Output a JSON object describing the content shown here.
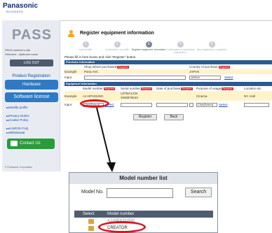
{
  "brand": {
    "name": "Panasonic",
    "sub": "BUSINESS"
  },
  "sidebar": {
    "logo": "PASS",
    "member_site": "PASS member's site",
    "welcome": "Welcome ,  lasthome name",
    "logout": "LOG OUT",
    "product_registration": "Product Registration",
    "hardware": "Hardware",
    "software_license": "Software license",
    "links": [
      "Modify profile",
      "Privacy Notice",
      "Cookie Policy",
      "KAIROS FAQ",
      "Withdrawal"
    ],
    "contact": "Contact Us",
    "copyright": "© Panasonic Corporation"
  },
  "main": {
    "title": "Register equipment information",
    "steps": [
      {
        "num": "1",
        "label": "Input profile"
      },
      {
        "num": "2",
        "label": "Confirmation of profile"
      },
      {
        "num": "3",
        "label": "Register equipment information"
      },
      {
        "num": "4",
        "label": "Confirmation of equipment registration"
      },
      {
        "num": "5",
        "label": "New registration completed"
      }
    ],
    "instruction": "Please fill in form boxes and click \"Register\" button.",
    "purchase_section": "Purchase information",
    "purchase_cols": {
      "shop": "Shop where purchased",
      "country": "Country of purchase"
    },
    "required": "Required",
    "example_label": "Example",
    "input_label": "Input",
    "purchase_example": {
      "shop": "Pana AVC",
      "country": "JAPAN"
    },
    "purchase_input": {
      "country": "JAPAN"
    },
    "select_link": "Select",
    "equipment_section": "Equipment information",
    "equip_cols": {
      "model": "Model number",
      "serial": "Serial number",
      "date": "Date of purchase",
      "purpose": "Purpose of usage",
      "location": "Location etc."
    },
    "equip_example": {
      "model": "AJ-HPX3100G",
      "serial1": "L8TMA1234",
      "serial2": "SW8876543",
      "purpose": "Cinema",
      "location": "NY, Hall"
    },
    "equip_input": {
      "model": "Click[Select]",
      "purpose": "Click[Select]"
    },
    "register": "Register",
    "back": "Back"
  },
  "popup": {
    "title": "Model number list",
    "model_label": "Model No.",
    "search": "Search",
    "col_select": "Select",
    "col_model": "Model number",
    "rows": [
      "AJ-HPX3100G",
      "CREATOR"
    ]
  }
}
